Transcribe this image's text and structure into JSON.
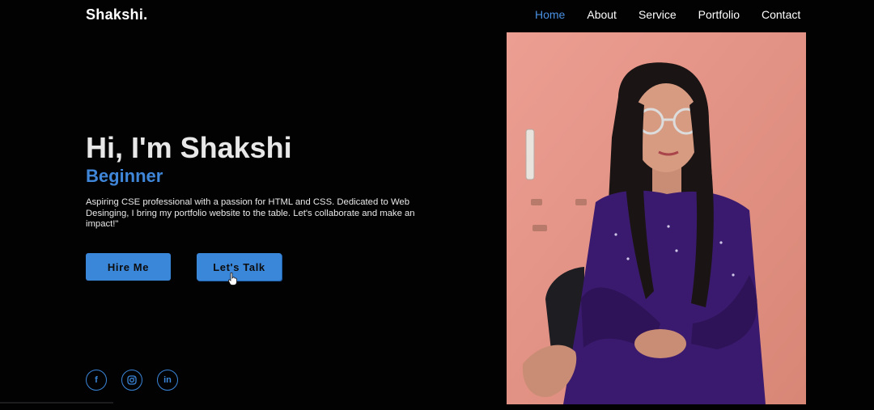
{
  "brand": {
    "logo": "Shakshi."
  },
  "nav": {
    "items": [
      {
        "label": "Home",
        "active": true
      },
      {
        "label": "About",
        "active": false
      },
      {
        "label": "Service",
        "active": false
      },
      {
        "label": "Portfolio",
        "active": false
      },
      {
        "label": "Contact",
        "active": false
      }
    ]
  },
  "hero": {
    "title": "Hi, I'm Shakshi",
    "subtitle": "Beginner",
    "description": "Aspiring CSE professional with a passion for HTML and CSS. Dedicated to Web Desinging, I bring my portfolio website to the table. Let's collaborate and make an impact!\"",
    "hire_button": "Hire Me",
    "talk_button": "Let's Talk"
  },
  "socials": [
    {
      "icon": "facebook-icon",
      "glyph": "f"
    },
    {
      "icon": "instagram-icon",
      "glyph": ""
    },
    {
      "icon": "linkedin-icon",
      "glyph": "in"
    }
  ],
  "colors": {
    "background": "#020203",
    "accent": "#3a86d9",
    "nav_active": "#4a90e2",
    "photo_wall": "#e69a8c",
    "dress": "#3a1a6e"
  }
}
